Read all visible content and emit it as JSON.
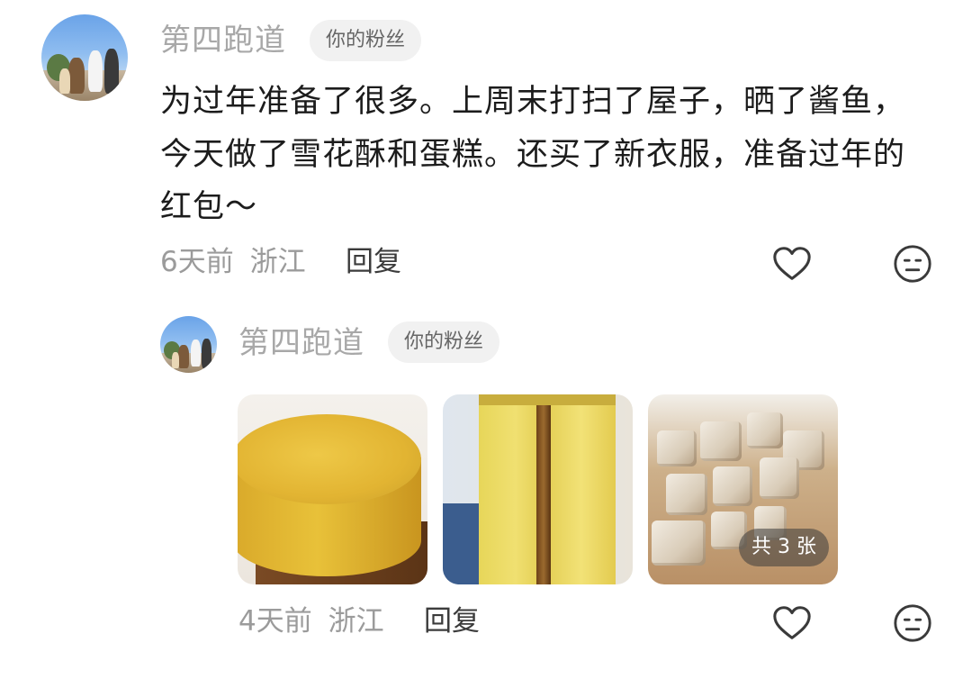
{
  "comments": [
    {
      "username": "第四跑道",
      "badge": "你的粉丝",
      "text": "为过年准备了很多。上周末打扫了屋子，晒了酱鱼，今天做了雪花酥和蛋糕。还买了新衣服，准备过年的红包～",
      "time": "6天前",
      "location": "浙江",
      "reply_label": "回复",
      "like_icon": "heart-icon",
      "react_icon": "emoji-face-icon"
    },
    {
      "username": "第四跑道",
      "badge": "你的粉丝",
      "images": [
        {
          "alt": "sponge cake"
        },
        {
          "alt": "cake slice"
        },
        {
          "alt": "snowflake crisp"
        }
      ],
      "image_count_label": "共 3 张",
      "time": "4天前",
      "location": "浙江",
      "reply_label": "回复",
      "like_icon": "heart-icon",
      "react_icon": "emoji-face-icon"
    }
  ],
  "colors": {
    "username": "#a8a8a8",
    "badge_bg": "#f1f1f1",
    "meta": "#9b9b9b",
    "text": "#1c1c1c"
  }
}
